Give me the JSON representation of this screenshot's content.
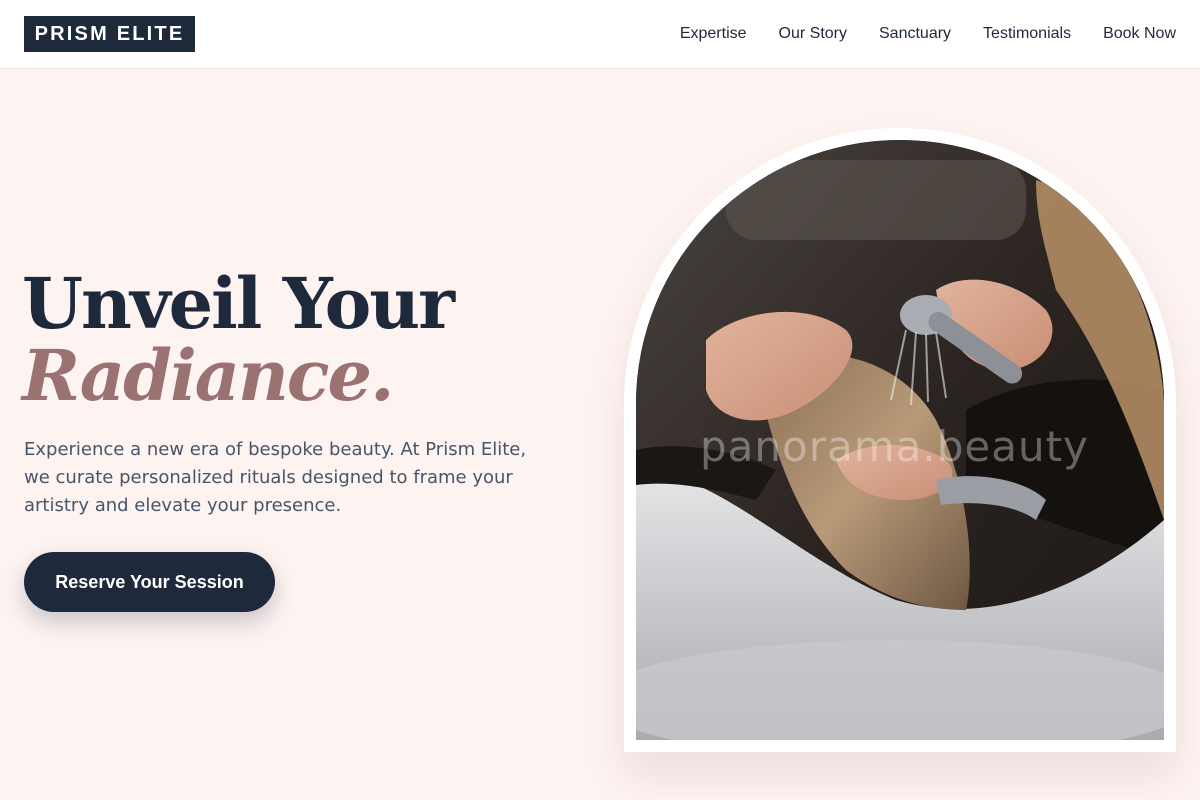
{
  "brand": {
    "logo_text": "PRISM ELITE",
    "dark": "#1e293b",
    "accent_rose": "#9b7272",
    "background": "#fdf3f1"
  },
  "nav": {
    "items": [
      {
        "label": "Expertise"
      },
      {
        "label": "Our Story"
      },
      {
        "label": "Sanctuary"
      },
      {
        "label": "Testimonials"
      },
      {
        "label": "Book Now"
      }
    ]
  },
  "hero": {
    "headline_line1": "Unveil Your",
    "headline_line2": "Radiance.",
    "description": "Experience a new era of bespoke beauty. At Prism Elite, we curate personalized rituals designed to frame your artistry and elevate your presence.",
    "cta_label": "Reserve Your Session",
    "image_watermark": "panorama.beauty"
  }
}
